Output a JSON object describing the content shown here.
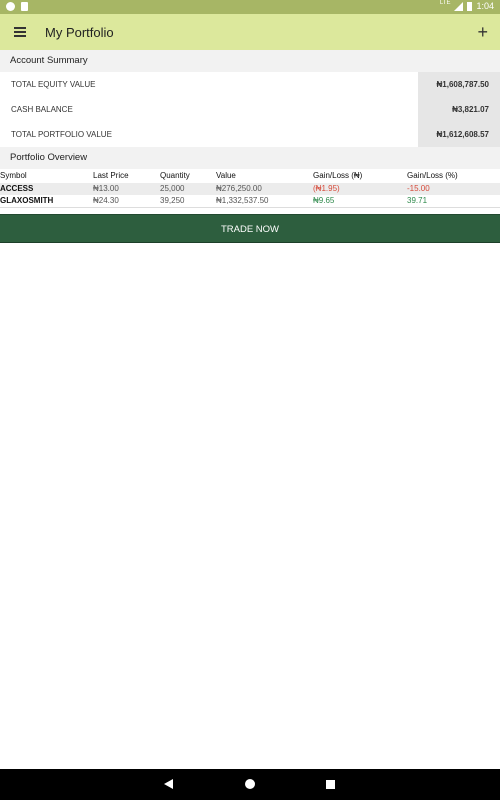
{
  "status_bar": {
    "network": "LTE",
    "time": "1:04"
  },
  "app_bar": {
    "title": "My Portfolio"
  },
  "account_summary": {
    "header": "Account Summary",
    "rows": [
      {
        "label": "TOTAL EQUITY VALUE",
        "value": "₦1,608,787.50"
      },
      {
        "label": "CASH BALANCE",
        "value": "₦3,821.07"
      },
      {
        "label": "TOTAL PORTFOLIO VALUE",
        "value": "₦1,612,608.57"
      }
    ]
  },
  "portfolio_overview": {
    "header": "Portfolio Overview",
    "columns": [
      "Symbol",
      "Last Price",
      "Quantity",
      "Value",
      "Gain/Loss (₦)",
      "Gain/Loss (%)"
    ],
    "rows": [
      {
        "symbol": "ACCESS",
        "last_price": "₦13.00",
        "quantity": "25,000",
        "value": "₦276,250.00",
        "gain_loss": "(₦1.95)",
        "gain_loss_pct": "-15.00"
      },
      {
        "symbol": "GLAXOSMITH",
        "last_price": "₦24.30",
        "quantity": "39,250",
        "value": "₦1,332,537.50",
        "gain_loss": "₦9.65",
        "gain_loss_pct": "39.71"
      }
    ]
  },
  "trade_button": {
    "label": "TRADE NOW"
  },
  "colors": {
    "status_bar": "#a7b665",
    "app_bar": "#dce89c",
    "trade_button": "#2d5e3e",
    "loss": "#d64a3a",
    "gain": "#2f8a4c"
  },
  "icons": [
    "settings-icon",
    "sd-card-icon",
    "signal-icon",
    "battery-icon",
    "menu-icon",
    "plus-icon",
    "back-icon",
    "home-icon",
    "recents-icon"
  ]
}
